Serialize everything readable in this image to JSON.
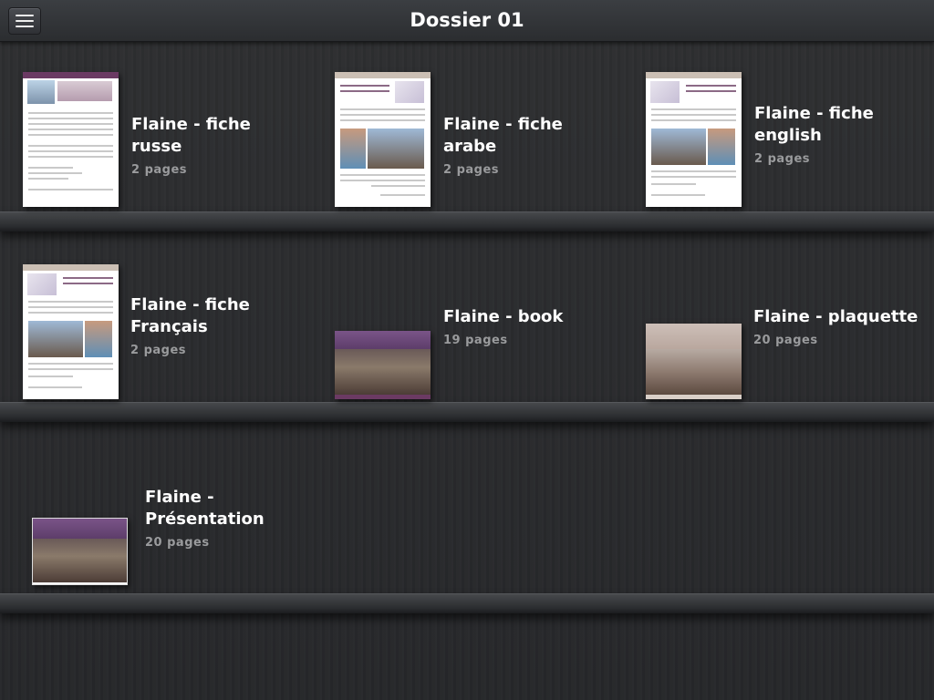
{
  "header": {
    "title": "Dossier 01",
    "menu_icon": "hamburger-menu-icon"
  },
  "books": [
    {
      "title": "Flaine - fiche russe",
      "pages": "2 pages"
    },
    {
      "title": "Flaine - fiche arabe",
      "pages": "2 pages"
    },
    {
      "title": "Flaine - fiche english",
      "pages": "2 pages"
    },
    {
      "title": "Flaine - fiche Français",
      "pages": "2 pages"
    },
    {
      "title": "Flaine - book",
      "pages": "19 pages"
    },
    {
      "title": "Flaine - plaquette",
      "pages": "20 pages"
    },
    {
      "title": "Flaine - Présentation",
      "pages": "20 pages"
    }
  ],
  "colors": {
    "accent_purple": "#6b3a63",
    "cover_beige": "#cbbfb4"
  }
}
